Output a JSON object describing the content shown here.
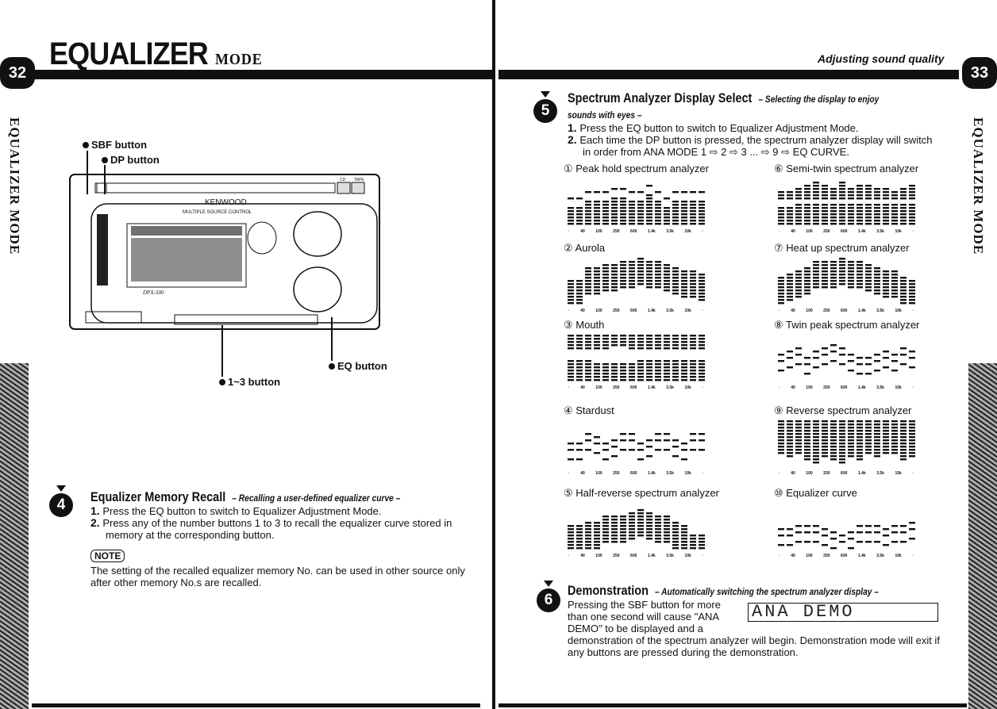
{
  "left_page": {
    "title": "EQUALIZER",
    "title_suffix": "MODE",
    "page_number": "32",
    "side_label": "EQUALIZER MODE",
    "callouts": {
      "sbf": "SBF button",
      "dp": "DP button",
      "eq": "EQ button",
      "num": "1~3 button"
    },
    "device": {
      "brand": "KENWOOD",
      "panel_label": "MULTIPLE SOURCE CONTROL",
      "model": "DPX-500",
      "cd": "CD",
      "tape": "TAPE"
    },
    "section4": {
      "number": "4",
      "title": "Equalizer Memory Recall",
      "subtitle": "– Recalling a user-defined equalizer curve –",
      "steps": [
        {
          "n": "1.",
          "text": "Press the EQ button to switch to Equalizer Adjustment Mode."
        },
        {
          "n": "2.",
          "text": "Press any of the number buttons 1 to 3 to recall the equalizer curve stored in memory at the corresponding button."
        }
      ],
      "note_label": "NOTE",
      "note_text": "The setting of the recalled equalizer memory No. can be used in other source only after other memory No.s are recalled."
    }
  },
  "right_page": {
    "header": "Adjusting sound quality",
    "page_number": "33",
    "side_label": "EQUALIZER MODE",
    "section5": {
      "number": "5",
      "title": "Spectrum Analyzer Display Select",
      "subtitle": "– Selecting the display to enjoy sounds with eyes –",
      "steps": [
        {
          "n": "1.",
          "text": "Press the EQ button to switch to Equalizer Adjustment Mode."
        },
        {
          "n": "2.",
          "text": "Each time the DP button is pressed, the spectrum analyzer display will switch in order from ANA MODE 1 ⇨ 2 ⇨ 3 ... ⇨ 9 ⇨ EQ CURVE."
        }
      ]
    },
    "freq_ticks": [
      "·",
      "40",
      "100",
      "250",
      "600",
      "1.4k",
      "3.5k",
      "10k",
      "·"
    ],
    "displays": [
      {
        "label": "① Peak hold spectrum analyzer",
        "levels": [
          0.6,
          0.6,
          0.75,
          0.7,
          0.7,
          0.8,
          0.8,
          0.75,
          0.75,
          0.85,
          0.7,
          0.6,
          0.75,
          0.7,
          0.75,
          0.75
        ],
        "style": "peak"
      },
      {
        "label": "② Aurola",
        "levels": [
          0.55,
          0.55,
          0.8,
          0.8,
          0.85,
          0.85,
          0.95,
          0.95,
          1,
          0.9,
          0.9,
          0.85,
          0.8,
          0.75,
          0.7,
          0.65
        ],
        "style": "aurola"
      },
      {
        "label": "③ Mouth",
        "levels": [
          0.9,
          0.9,
          0.9,
          0.85,
          0.85,
          0.8,
          0.8,
          0.85,
          0.9,
          0.95,
          0.95,
          0.95,
          0.95,
          0.95,
          0.95,
          0.95
        ],
        "style": "mouth"
      },
      {
        "label": "④ Stardust",
        "levels": [
          0.5,
          0.55,
          0.7,
          0.65,
          0.55,
          0.6,
          0.75,
          0.7,
          0.5,
          0.6,
          0.75,
          0.7,
          0.6,
          0.55,
          0.7,
          0.7
        ],
        "style": "dust"
      },
      {
        "label": "⑤ Half-reverse spectrum analyzer",
        "levels": [
          0.55,
          0.55,
          0.6,
          0.6,
          0.7,
          0.75,
          0.7,
          0.8,
          0.85,
          0.8,
          0.7,
          0.7,
          0.6,
          0.55,
          0.35,
          0.35
        ],
        "style": "half"
      },
      {
        "label": "⑥ Semi-twin spectrum analyzer",
        "levels": [
          0.4,
          0.4,
          0.6,
          0.7,
          0.8,
          0.75,
          0.6,
          0.85,
          0.5,
          0.7,
          0.65,
          0.6,
          0.5,
          0.45,
          0.6,
          0.7
        ],
        "style": "twin"
      },
      {
        "label": "⑦ Heat up spectrum analyzer",
        "levels": [
          0.6,
          0.65,
          0.7,
          0.8,
          0.9,
          0.9,
          0.95,
          1,
          0.95,
          0.9,
          0.85,
          0.8,
          0.75,
          0.7,
          0.6,
          0.55
        ],
        "style": "heat"
      },
      {
        "label": "⑧ Twin peak spectrum analyzer",
        "levels": [
          0.6,
          0.65,
          0.7,
          0.55,
          0.65,
          0.75,
          0.8,
          0.7,
          0.6,
          0.55,
          0.5,
          0.6,
          0.65,
          0.6,
          0.7,
          0.65
        ],
        "style": "dust"
      },
      {
        "label": "⑨ Reverse spectrum analyzer",
        "levels": [
          0.7,
          0.8,
          0.75,
          0.85,
          0.9,
          0.8,
          0.85,
          0.9,
          0.8,
          0.85,
          0.75,
          0.8,
          0.7,
          0.75,
          0.85,
          0.8
        ],
        "style": "reverse"
      },
      {
        "label": "⑩ Equalizer curve",
        "levels": [
          0.45,
          0.45,
          0.5,
          0.55,
          0.5,
          0.45,
          0.4,
          0.35,
          0.4,
          0.5,
          0.55,
          0.5,
          0.45,
          0.5,
          0.55,
          0.6
        ],
        "style": "dust"
      }
    ],
    "section6": {
      "number": "6",
      "title": "Demonstration",
      "subtitle": "– Automatically switching the spectrum analyzer display –",
      "text_a": "Pressing the SBF button for more than one second will cause \"ANA DEMO\" to be displayed and a",
      "text_b": "demonstration of the spectrum analyzer will begin. Demonstration mode will exit if any buttons are pressed during the demonstration.",
      "display_text": "ANA DEMO"
    }
  }
}
